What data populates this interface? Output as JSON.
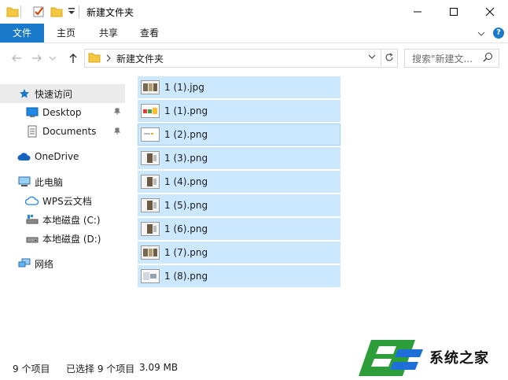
{
  "window": {
    "title": "新建文件夹"
  },
  "ribbon": {
    "tabs": [
      {
        "label": "文件"
      },
      {
        "label": "主页"
      },
      {
        "label": "共享"
      },
      {
        "label": "查看"
      }
    ]
  },
  "address": {
    "path": "新建文件夹",
    "search_placeholder": "搜索\"新建文..."
  },
  "nav": {
    "quick_access": "快速访问",
    "desktop": "Desktop",
    "documents": "Documents",
    "onedrive": "OneDrive",
    "this_pc": "此电脑",
    "wps": "WPS云文档",
    "disk_c": "本地磁盘 (C:)",
    "disk_d": "本地磁盘 (D:)",
    "network": "网络"
  },
  "files": [
    {
      "name": "1 (1).jpg"
    },
    {
      "name": "1 (1).png"
    },
    {
      "name": "1 (2).png"
    },
    {
      "name": "1 (3).png"
    },
    {
      "name": "1 (4).png"
    },
    {
      "name": "1 (5).png"
    },
    {
      "name": "1 (6).png"
    },
    {
      "name": "1 (7).png"
    },
    {
      "name": "1 (8).png"
    }
  ],
  "status": {
    "count": "9 个项目",
    "selected": "已选择 9 个项目",
    "size": "3.09 MB"
  },
  "watermark": {
    "text": "系统之家"
  },
  "colors": {
    "accent": "#1979ca",
    "selection": "#cce8ff",
    "selection_border": "#99d1ff",
    "folder": "#f5c842"
  }
}
